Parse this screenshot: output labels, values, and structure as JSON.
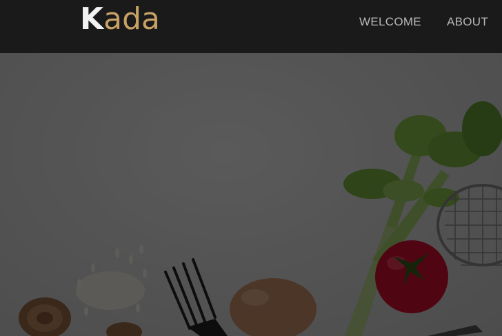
{
  "brand": {
    "logo_first": "K",
    "logo_rest": "ada",
    "accent_color": "#c8a165"
  },
  "nav": {
    "items": [
      {
        "label": "WELCOME"
      },
      {
        "label": "ABOUT"
      }
    ]
  },
  "hero": {
    "image_subject": "food-ingredients-photo",
    "icons": [
      "mushroom-icon",
      "rice-icon",
      "fork-icon",
      "egg-icon",
      "tomato-icon",
      "celery-icon",
      "wire-basket-icon"
    ]
  }
}
